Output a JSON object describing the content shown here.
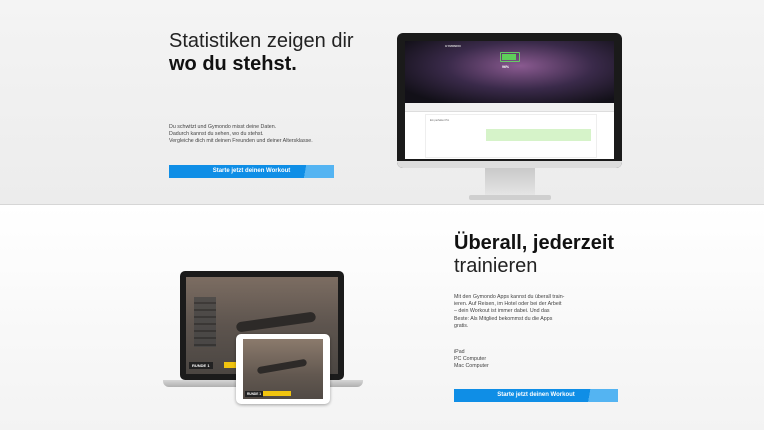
{
  "section_stats": {
    "title_line1": "Statistiken zeigen dir",
    "title_line2": "wo du stehst.",
    "body_line1": "Du schwitzt und Gymondo misst deine Daten.",
    "body_line2": "Dadurch kannst du sehen, wo du stehst.",
    "body_line3": "Vergleiche dich mit deinen Freunden und deiner Altersklasse.",
    "cta_label": "Starte jetzt deinen Workout",
    "device": "imac",
    "device_screen": {
      "logo": "GYMONDO",
      "percent": "96%",
      "chart_title": "Ein perfekter Pin"
    }
  },
  "section_anywhere": {
    "title_line1": "Überall, jederzeit",
    "title_line2": "trainieren",
    "body_line1": "Mit den Gymondo Apps kannst du überall train-",
    "body_line2": "ieren. Auf Reisen, im Hotel oder bei der Arbeit",
    "body_line3": "– dein Workout ist immer dabei. Und das",
    "body_line4": "Beste: Als Mitglied bekommst du die Apps",
    "body_line5": "gratis.",
    "devices": [
      "iPad",
      "PC Computer",
      "Mac Computer"
    ],
    "cta_label": "Starte jetzt deinen Workout",
    "laptop_label": "RUNDE 1",
    "ipad_label": "RUNDE 1"
  },
  "colors": {
    "cta_blue": "#0f8ee6",
    "cta_highlight": "#54b4f2",
    "battery_green": "#5fd05a",
    "progress_yellow": "#f1c40f"
  }
}
